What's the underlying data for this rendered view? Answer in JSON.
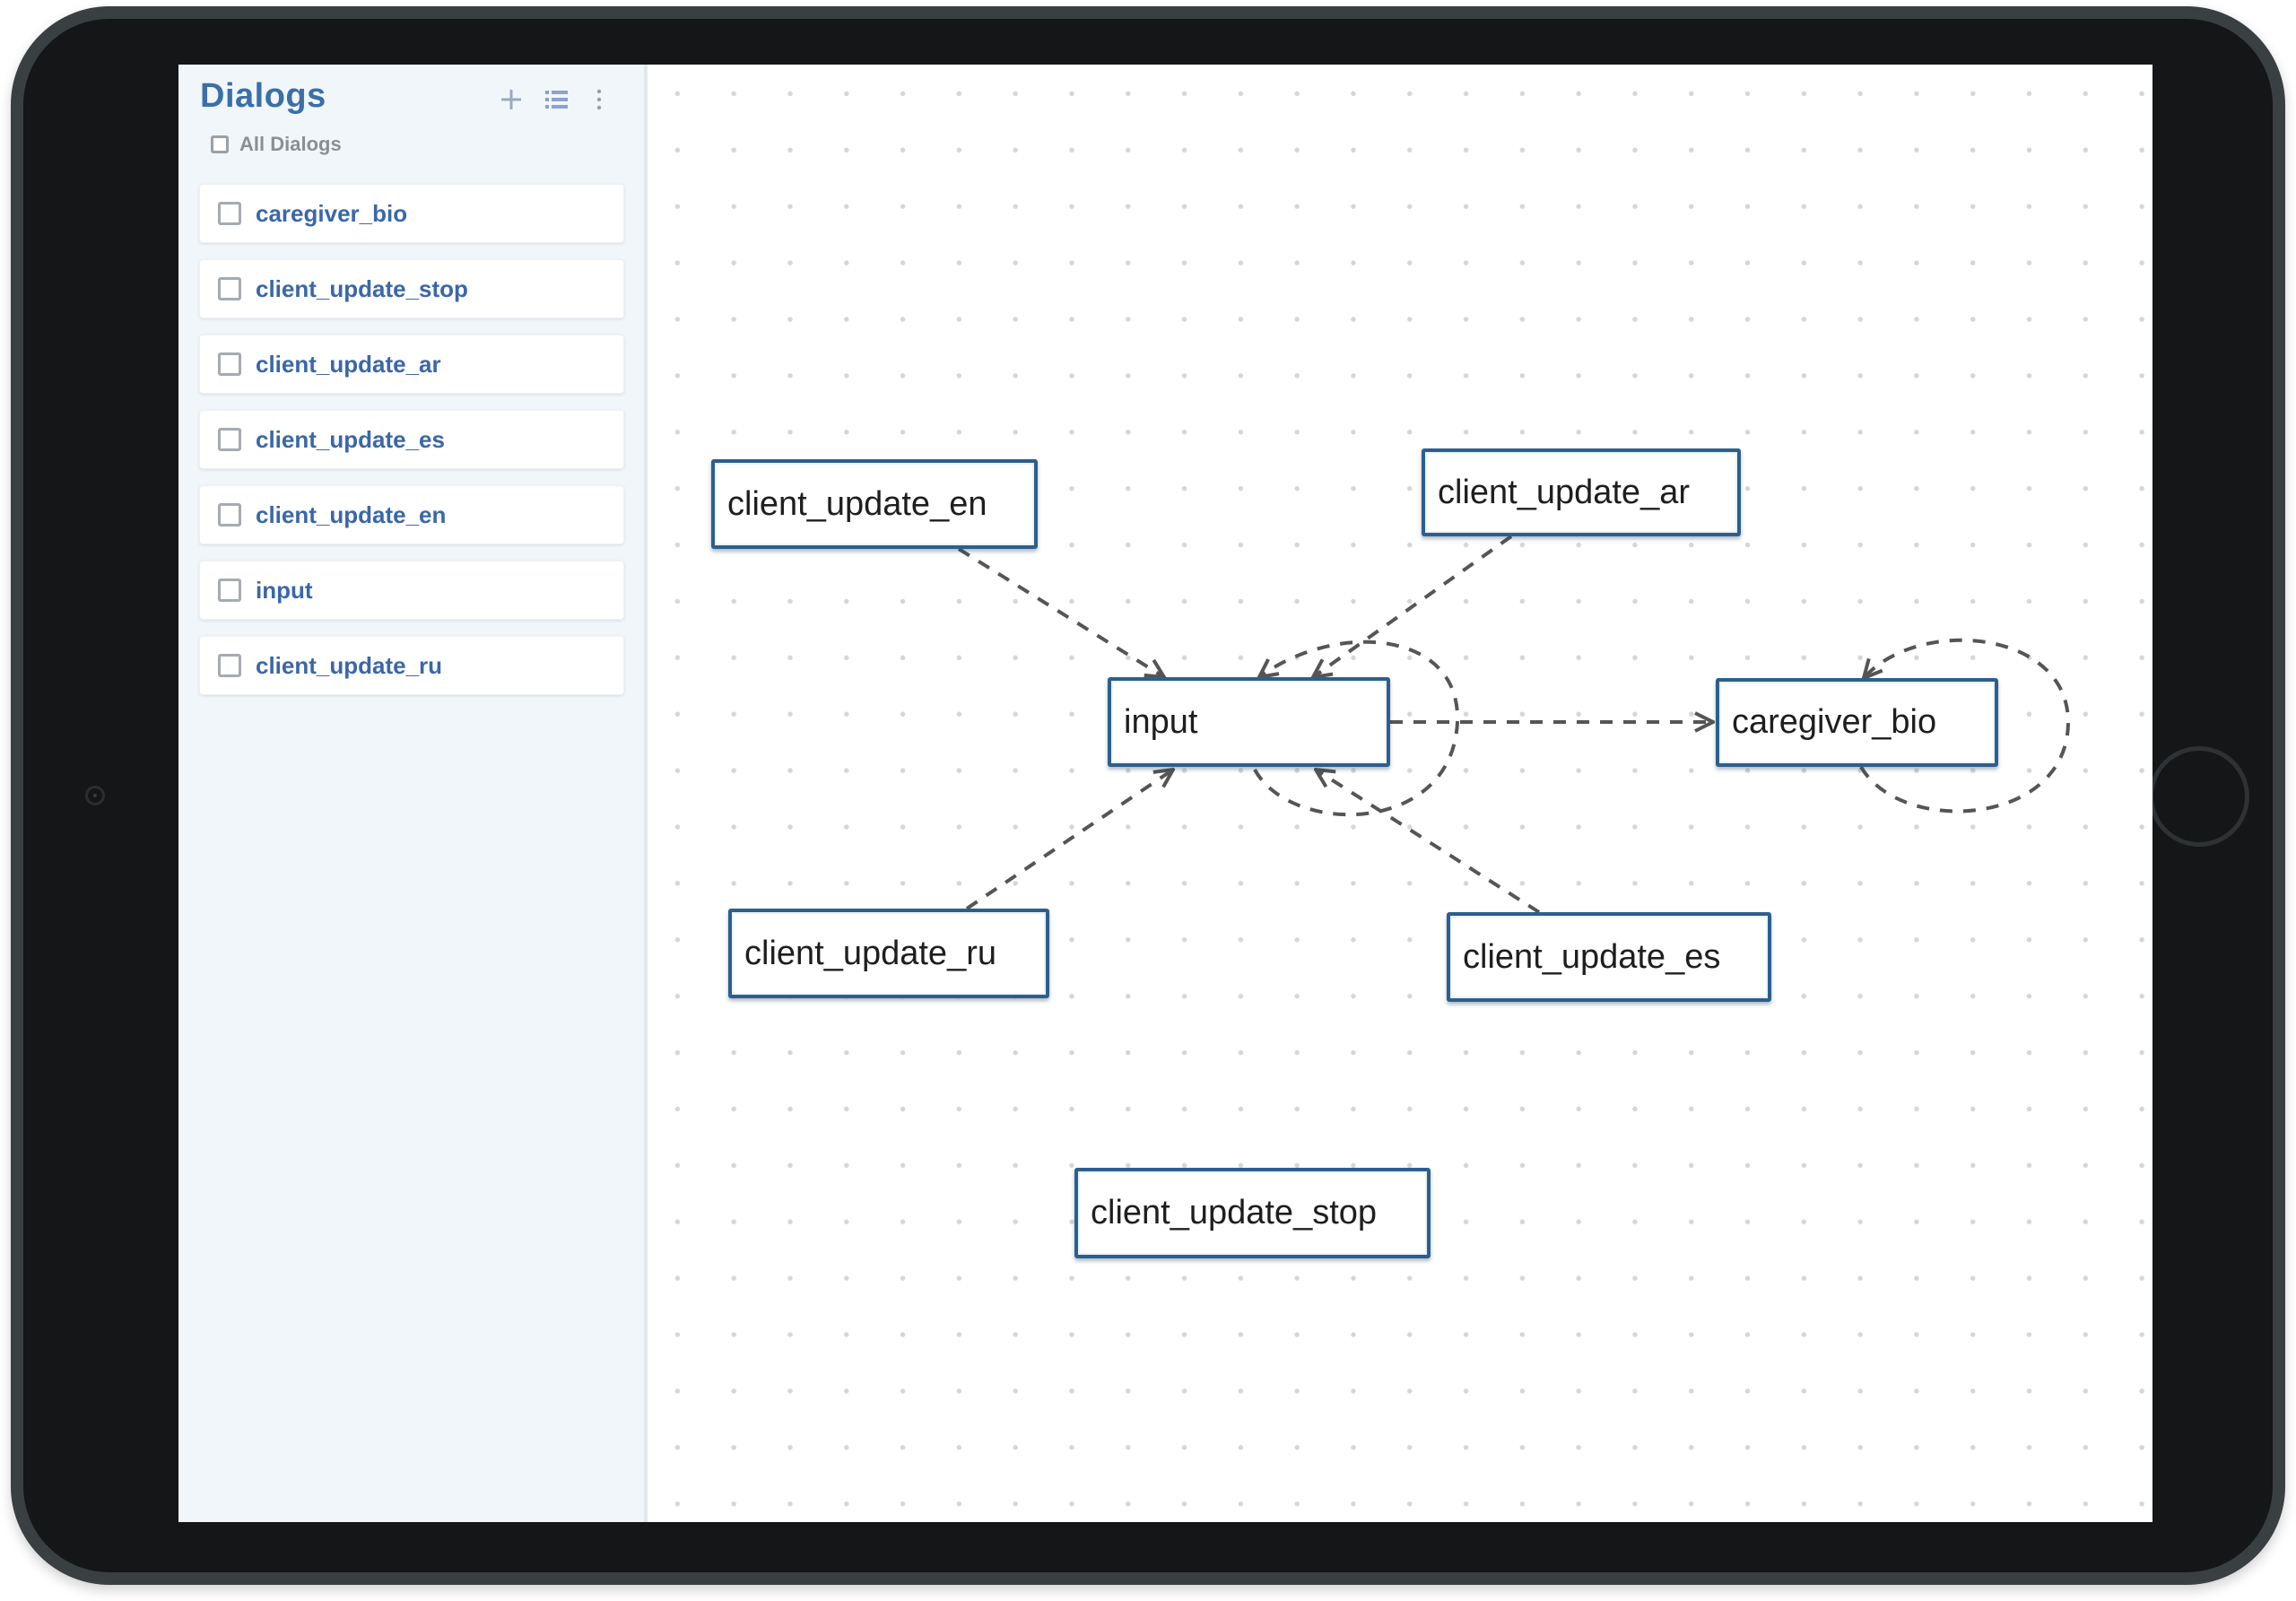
{
  "sidebar": {
    "title": "Dialogs",
    "icons": {
      "add": "plus-icon",
      "list": "list-icon",
      "more": "more-vertical-icon"
    },
    "all_label": "All Dialogs",
    "items": [
      {
        "label": "caregiver_bio",
        "checked": false
      },
      {
        "label": "client_update_stop",
        "checked": false
      },
      {
        "label": "client_update_ar",
        "checked": false
      },
      {
        "label": "client_update_es",
        "checked": false
      },
      {
        "label": "client_update_en",
        "checked": false
      },
      {
        "label": "input",
        "checked": false
      },
      {
        "label": "client_update_ru",
        "checked": false
      }
    ]
  },
  "diagram": {
    "nodes": {
      "client_update_en": "client_update_en",
      "client_update_ar": "client_update_ar",
      "input": "input",
      "caregiver_bio": "caregiver_bio",
      "client_update_ru": "client_update_ru",
      "client_update_es": "client_update_es",
      "client_update_stop": "client_update_stop"
    },
    "edges": [
      {
        "from": "client_update_en",
        "to": "input"
      },
      {
        "from": "client_update_ar",
        "to": "input"
      },
      {
        "from": "client_update_ru",
        "to": "input"
      },
      {
        "from": "client_update_es",
        "to": "input"
      },
      {
        "from": "input",
        "to": "caregiver_bio"
      },
      {
        "from": "input",
        "to": "input"
      },
      {
        "from": "caregiver_bio",
        "to": "caregiver_bio"
      }
    ]
  },
  "colors": {
    "accent": "#3a6fa8",
    "node_border": "#2d5f8e",
    "sidebar_bg": "#f1f6fa",
    "edge": "#555555"
  }
}
